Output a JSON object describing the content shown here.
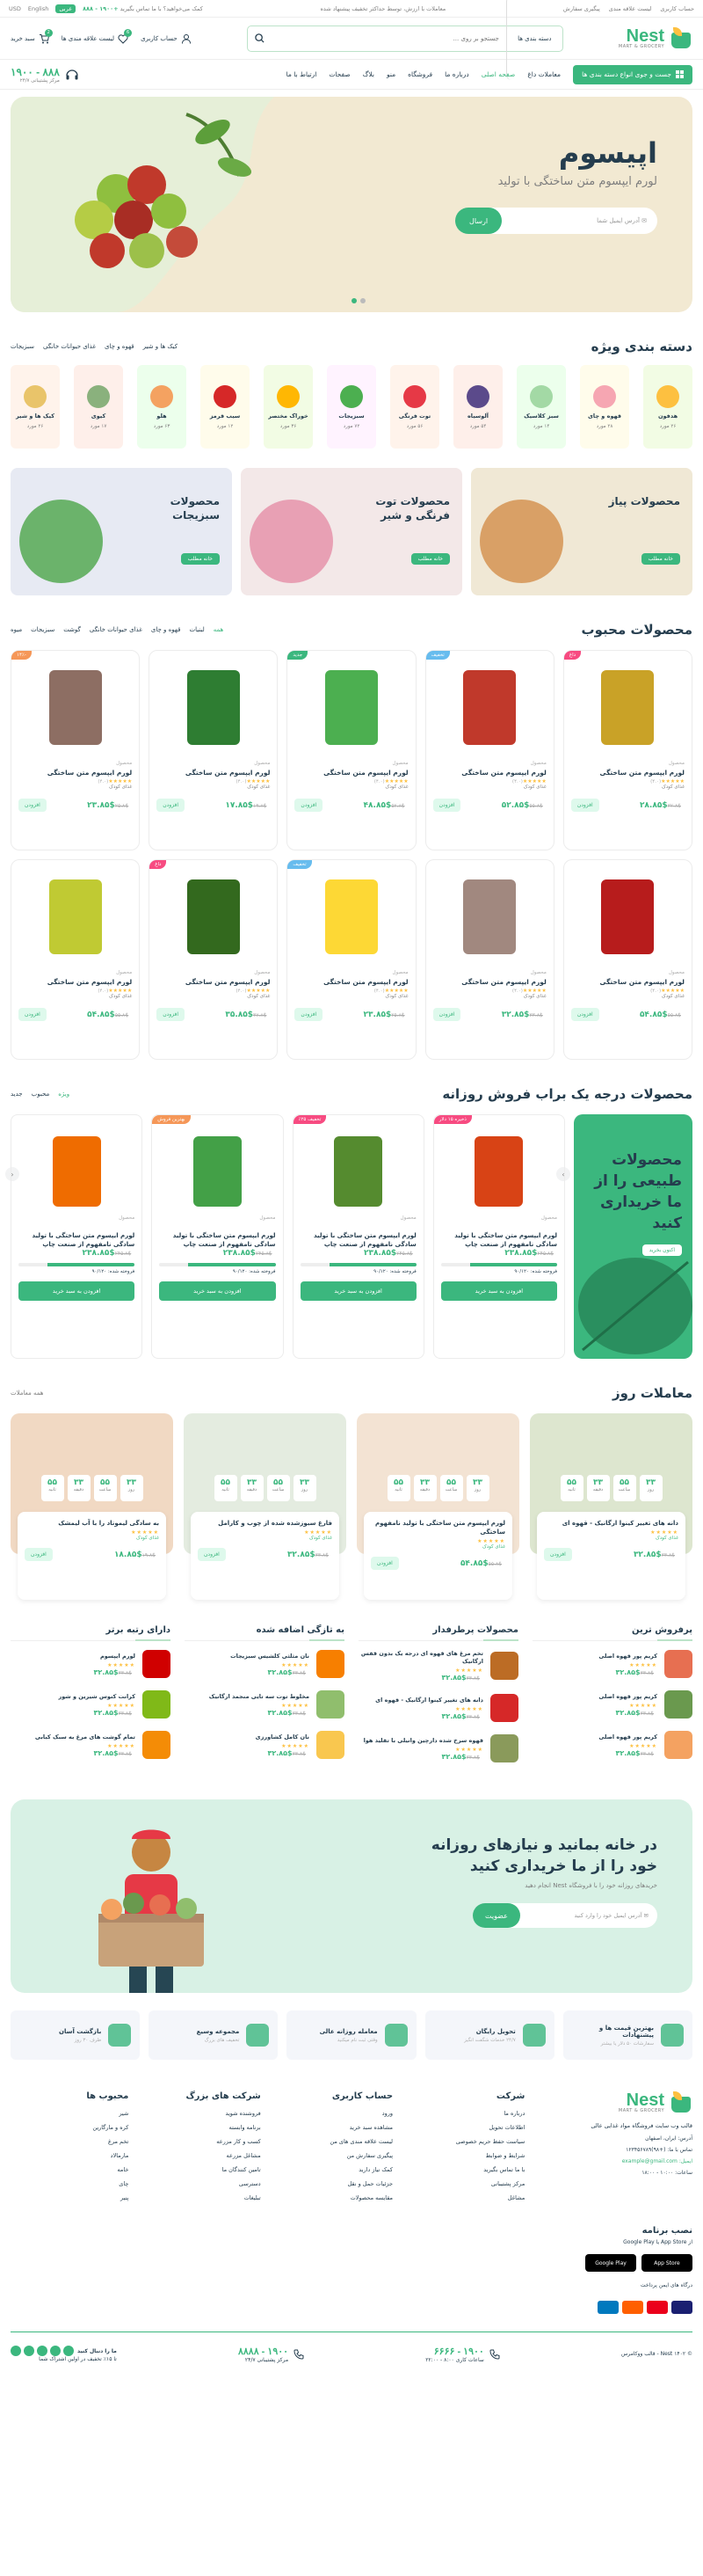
{
  "topbar": {
    "links": [
      "حساب کاربری",
      "لیست علاقه مندی",
      "پیگیری سفارش"
    ],
    "notice": "معاملات با ارزش، توسط حداکثر تخفیف پیشنهاد شده",
    "help": "کمک می‌خواهید؟ با ما تماس بگیرید",
    "phone": "+۱۹۰۰ - ۸۸۸",
    "lang": "English",
    "currency": "USD",
    "lang_badge": "عربی"
  },
  "header": {
    "logo": "Nest",
    "logo_sub": "MART & GROCERY",
    "search_cat": "دسته بندی ها",
    "search_placeholder": "جستجو بر روی ...",
    "account": "حساب کاربری",
    "wishlist": "لیست علاقه مندی ها",
    "wishlist_count": "6",
    "cart": "سبد خرید",
    "cart_count": "2"
  },
  "nav": {
    "allcats": "جست و جوی انواع دسته بندی ها",
    "items": [
      "معاملات داغ",
      "صفحه اصلی",
      "درباره ما",
      "فروشگاه",
      "منو",
      "بلاگ",
      "صفحات",
      "ارتباط با ما"
    ],
    "hotline": "۸۸۸ - ۱۹۰۰",
    "hotline_sub": "مرکز پشتیبانی ۲۴/۷"
  },
  "hero": {
    "title": "اپیسوم",
    "subtitle": "لورم ایپسوم متن ساختگی با تولید",
    "email_placeholder": "آدرس ایمیل شما",
    "button": "ارسال"
  },
  "categories": {
    "title": "دسته بندی ویژه",
    "tabs": [
      "کیک ها و شیر",
      "قهوه و چای",
      "غذای حیوانات خانگی",
      "سبزیجات"
    ],
    "items": [
      {
        "name": "هدفون",
        "count": "۲۶ مورد",
        "bg": "#f2fce4",
        "dot": "#fdc040"
      },
      {
        "name": "قهوه و چای",
        "count": "۲۸ مورد",
        "bg": "#fffceb",
        "dot": "#f6a6b2"
      },
      {
        "name": "سبز کلاسیک",
        "count": "۱۴ مورد",
        "bg": "#ecffec",
        "dot": "#a3d9a5"
      },
      {
        "name": "آلوسیاه",
        "count": "۵۴ مورد",
        "bg": "#feefea",
        "dot": "#5b4a8b"
      },
      {
        "name": "توت فرنگی",
        "count": "۵۶ مورد",
        "bg": "#fff3eb",
        "dot": "#e63946"
      },
      {
        "name": "سبزیجات",
        "count": "۷۲ مورد",
        "bg": "#fff3ff",
        "dot": "#4caf50"
      },
      {
        "name": "خوراک مختصر",
        "count": "۳۶ مورد",
        "bg": "#f2fce4",
        "dot": "#ffb703"
      },
      {
        "name": "سیب قرمز",
        "count": "۱۲ مورد",
        "bg": "#fffceb",
        "dot": "#d62828"
      },
      {
        "name": "هلو",
        "count": "۶۳ مورد",
        "bg": "#ecffec",
        "dot": "#f4a261"
      },
      {
        "name": "کیوی",
        "count": "۱۷ مورد",
        "bg": "#feefea",
        "dot": "#8ab17d"
      },
      {
        "name": "کیک ها و شیر",
        "count": "۲۶ مورد",
        "bg": "#fff3eb",
        "dot": "#e9c46a"
      }
    ]
  },
  "banners": [
    {
      "title": "محصولات پیاز",
      "button": "خانه مطلب",
      "bg": "#f0e8d5",
      "art": "#d9a066"
    },
    {
      "title": "محصولات توت فرنگی و شیر",
      "button": "خانه مطلب",
      "bg": "#f3e8e8",
      "art": "#e8a0b4"
    },
    {
      "title": "محصولات سبزیجات",
      "button": "خانه مطلب",
      "bg": "#e7eaf3",
      "art": "#6bb36b"
    }
  ],
  "popular": {
    "title": "محصولات محبوب",
    "tabs": [
      "همه",
      "لبنیات",
      "قهوه و چای",
      "غذای حیوانات خانگی",
      "گوشت",
      "سبزیجات",
      "میوه"
    ],
    "products": [
      {
        "tag": "داغ",
        "tag_color": "#f74b81",
        "img": "#c9a227",
        "cat": "محصول",
        "name": "لورم ایپسوم متن ساختگی",
        "rating": "(۴.۰)",
        "by": "غذای کودک",
        "price": "۲۸.۸۵$",
        "old": "۳۲.۸$",
        "add": "افزودن"
      },
      {
        "tag": "تخفیف",
        "tag_color": "#67bcee",
        "img": "#c0392b",
        "cat": "محصول",
        "name": "لورم ایپسوم متن ساختگی",
        "rating": "(۴.۰)",
        "by": "غذای کودک",
        "price": "۵۲.۸۵$",
        "old": "۵۵.۸$",
        "add": "افزودن"
      },
      {
        "tag": "جدید",
        "tag_color": "#3bb77e",
        "img": "#4caf50",
        "cat": "محصول",
        "name": "لورم ایپسوم متن ساختگی",
        "rating": "(۴.۰)",
        "by": "غذای کودک",
        "price": "۴۸.۸۵$",
        "old": "۵۲.۸$",
        "add": "افزودن"
      },
      {
        "tag": "",
        "tag_color": "",
        "img": "#2e7d32",
        "cat": "محصول",
        "name": "لورم ایپسوم متن ساختگی",
        "rating": "(۴.۰)",
        "by": "غذای کودک",
        "price": "۱۷.۸۵$",
        "old": "۱۹.۸$",
        "add": "افزودن"
      },
      {
        "tag": "-۱۴٪",
        "tag_color": "#f59758",
        "img": "#8d6e63",
        "cat": "محصول",
        "name": "لورم ایپسوم متن ساختگی",
        "rating": "(۴.۰)",
        "by": "غذای کودک",
        "price": "۲۳.۸۵$",
        "old": "۲۵.۸$",
        "add": "افزودن"
      },
      {
        "tag": "",
        "tag_color": "",
        "img": "#b71c1c",
        "cat": "محصول",
        "name": "لورم ایپسوم متن ساختگی",
        "rating": "(۴.۰)",
        "by": "غذای کودک",
        "price": "۵۴.۸۵$",
        "old": "۵۵.۸$",
        "add": "افزودن"
      },
      {
        "tag": "",
        "tag_color": "",
        "img": "#a1887f",
        "cat": "محصول",
        "name": "لورم ایپسوم متن ساختگی",
        "rating": "(۴.۰)",
        "by": "غذای کودک",
        "price": "۳۲.۸۵$",
        "old": "۳۳.۸$",
        "add": "افزودن"
      },
      {
        "tag": "تخفیف",
        "tag_color": "#67bcee",
        "img": "#fdd835",
        "cat": "محصول",
        "name": "لورم ایپسوم متن ساختگی",
        "rating": "(۴.۰)",
        "by": "غذای کودک",
        "price": "۲۳.۸۵$",
        "old": "۲۵.۸$",
        "add": "افزودن"
      },
      {
        "tag": "داغ",
        "tag_color": "#f74b81",
        "img": "#33691e",
        "cat": "محصول",
        "name": "لورم ایپسوم متن ساختگی",
        "rating": "(۴.۰)",
        "by": "غذای کودک",
        "price": "۳۵.۸۵$",
        "old": "۳۷.۸$",
        "add": "افزودن"
      },
      {
        "tag": "",
        "tag_color": "",
        "img": "#c0ca33",
        "cat": "محصول",
        "name": "لورم ایپسوم متن ساختگی",
        "rating": "(۴.۰)",
        "by": "غذای کودک",
        "price": "۵۴.۸۵$",
        "old": "۵۵.۸$",
        "add": "افزودن"
      }
    ]
  },
  "daily": {
    "title": "محصولات درجه یک براب فروش روزانه",
    "tabs": [
      "ویژه",
      "محبوب",
      "جدید"
    ],
    "banner_title": "محصولات طبیعی را از ما خریداری کنید",
    "banner_button": "اکنون بخرید",
    "items": [
      {
        "tag": "ذخیره ۱۵ دلار",
        "tag_color": "#f74b81",
        "img": "#d84315",
        "cat": "محصول",
        "name": "لورم ایپسوم متن ساختگی با تولید سادگی نامفهوم از صنعت چاپ",
        "price": "۲۳۸.۸۵$",
        "old": "۲۴۵.۸$",
        "sold_label": "فروخته شده: ۹۰/۱۲۰",
        "sold_pct": 75,
        "button": "افزودن به سبد خرید"
      },
      {
        "tag": "تخفیف ۲۵٪",
        "tag_color": "#f74b81",
        "img": "#558b2f",
        "cat": "محصول",
        "name": "لورم ایپسوم متن ساختگی با تولید سادگی نامفهوم از صنعت چاپ",
        "price": "۲۳۸.۸۵$",
        "old": "۲۴۵.۸$",
        "sold_label": "فروخته شده: ۹۰/۱۲۰",
        "sold_pct": 75,
        "button": "افزودن به سبد خرید"
      },
      {
        "tag": "بهترین فروش",
        "tag_color": "#f59758",
        "img": "#43a047",
        "cat": "محصول",
        "name": "لورم ایپسوم متن ساختگی با تولید سادگی نامفهوم از صنعت چاپ",
        "price": "۲۳۸.۸۵$",
        "old": "۲۴۵.۸$",
        "sold_label": "فروخته شده: ۹۰/۱۲۰",
        "sold_pct": 75,
        "button": "افزودن به سبد خرید"
      },
      {
        "tag": "",
        "tag_color": "",
        "img": "#ef6c00",
        "cat": "محصول",
        "name": "لورم ایپسوم متن ساختگی با تولید سادگی نامفهوم از صنعت چاپ",
        "price": "۲۳۸.۸۵$",
        "old": "۲۴۵.۸$",
        "sold_label": "فروخته شده: ۹۰/۱۲۰",
        "sold_pct": 75,
        "button": "افزودن به سبد خرید"
      }
    ]
  },
  "deals": {
    "title": "معاملات روز",
    "all": "همه معاملات",
    "items": [
      {
        "pic": "#dde6cf",
        "timer": [
          "۳۳",
          "۵۵",
          "۳۳",
          "۵۵"
        ],
        "units": [
          "روز",
          "ساعت",
          "دقیقه",
          "ثانیه"
        ],
        "name": "دانه های تغییر کینوا ارگانیک - قهوه ای",
        "by": "غذای کودک",
        "price": "۳۲.۸۵$",
        "old": "۳۳.۸$",
        "add": "افزودن"
      },
      {
        "pic": "#f3e3d3",
        "timer": [
          "۳۳",
          "۵۵",
          "۳۳",
          "۵۵"
        ],
        "units": [
          "روز",
          "ساعت",
          "دقیقه",
          "ثانیه"
        ],
        "name": "لورم ایپسوم متن ساختگی با تولید نامفهوم ساختگی",
        "by": "غذای کودک",
        "price": "۵۴.۸۵$",
        "old": "۵۵.۸$",
        "add": "افزودن"
      },
      {
        "pic": "#e4ece0",
        "timer": [
          "۳۳",
          "۵۵",
          "۳۳",
          "۵۵"
        ],
        "units": [
          "روز",
          "ساعت",
          "دقیقه",
          "ثانیه"
        ],
        "name": "فارغ سبوزشده شده از چوب و کارامل",
        "by": "غذای کودک",
        "price": "۳۲.۸۵$",
        "old": "۳۳.۸$",
        "add": "افزودن"
      },
      {
        "pic": "#f1d9c3",
        "timer": [
          "۳۳",
          "۵۵",
          "۳۳",
          "۵۵"
        ],
        "units": [
          "روز",
          "ساعت",
          "دقیقه",
          "ثانیه"
        ],
        "name": "به سادگی لیموناد را با آب لیمشک",
        "by": "غذای کودک",
        "price": "۱۸.۸۵$",
        "old": "۱۹.۸$",
        "add": "افزودن"
      }
    ]
  },
  "columns": [
    {
      "title": "پرفروش ترین",
      "items": [
        {
          "img": "#e76f51",
          "name": "کریم پور قهوه اصلی",
          "price": "۳۲.۸۵$",
          "old": "۳۳.۸$"
        },
        {
          "img": "#6a994e",
          "name": "کریم پور قهوه اصلی",
          "price": "۳۲.۸۵$",
          "old": "۳۳.۸$"
        },
        {
          "img": "#f4a261",
          "name": "کریم پور قهوه اصلی",
          "price": "۳۲.۸۵$",
          "old": "۳۳.۸$"
        }
      ]
    },
    {
      "title": "محصولات پرطرفدار",
      "items": [
        {
          "img": "#bc6c25",
          "name": "تخم مرغ های قهوه ای درجه یک بدون قفس ارگانیک",
          "price": "۳۲.۸۵$",
          "old": "۳۳.۸$"
        },
        {
          "img": "#d62828",
          "name": "دانه های تغییر کینوا ارگانیک - قهوه ای",
          "price": "۳۲.۸۵$",
          "old": "۳۳.۸$"
        },
        {
          "img": "#8a9a5b",
          "name": "قهوه سرخ شده دارچین وانیلی با تقلید هوا",
          "price": "۳۲.۸۵$",
          "old": "۳۳.۸$"
        }
      ]
    },
    {
      "title": "به تازگی اضافه شده",
      "items": [
        {
          "img": "#f77f00",
          "name": "نان مثلثی کلشیس سبزیجات",
          "price": "۳۲.۸۵$",
          "old": "۳۳.۸$"
        },
        {
          "img": "#90be6d",
          "name": "مخلوط توت سه تایی منجمد ارگانیک",
          "price": "۳۲.۸۵$",
          "old": "۳۳.۸$"
        },
        {
          "img": "#f9c74f",
          "name": "نان کامل کشاورزی",
          "price": "۳۲.۸۵$",
          "old": "۳۳.۸$"
        }
      ]
    },
    {
      "title": "دارای رتبه برتر",
      "items": [
        {
          "img": "#d00000",
          "name": "لورم ایپسوم",
          "price": "۳۲.۸۵$",
          "old": "۳۳.۸$"
        },
        {
          "img": "#80b918",
          "name": "کرانت کنوس شیرین و شور",
          "price": "۳۲.۸۵$",
          "old": "۳۳.۸$"
        },
        {
          "img": "#f48c06",
          "name": "تمام گوشت های مرغ به سبک کبابی",
          "price": "۳۲.۸۵$",
          "old": "۳۳.۸$"
        }
      ]
    }
  ],
  "newsletter": {
    "title": "در خانه بمانید و نیازهای روزانه خود را از ما خریداری کنید",
    "subtitle": "خریدهای روزانه خود را با فروشگاه Nest انجام دهید",
    "placeholder": "آدرس ایمیل خود را وارد کنید",
    "button": "عضویت"
  },
  "features": [
    {
      "title": "بهترین قیمت ها و پیشنهادات",
      "sub": "سفارشات ۵۰ دلار یا بیشتر"
    },
    {
      "title": "تحویل رایگان",
      "sub": "۲۴/۷ خدمات شگفت انگیز"
    },
    {
      "title": "معامله روزانه عالی",
      "sub": "وقتی ثبت نام میکنید"
    },
    {
      "title": "مجموعه وسیع",
      "sub": "تخفیف های بزرگ"
    },
    {
      "title": "بازگشت آسان",
      "sub": "ظرف ۳۰ روز"
    }
  ],
  "footer": {
    "about": "قالب وب سایت فروشگاه مواد غذایی عالی",
    "address": "آدرس: ایران، اصفهان",
    "phone": "تماس با ما: (+۹۸)۱۲۳۴۵۶۷۸۹",
    "email": "ایمیل: example@gmail.com",
    "hours": "ساعات: ۱۰:۰۰ - ۱۸:۰۰",
    "cols": [
      {
        "title": "شرکت",
        "items": [
          "درباره ما",
          "اطلاعات تحویل",
          "سیاست حفظ حریم خصوصی",
          "شرایط و ضوابط",
          "با ما تماس بگیرید",
          "مرکز پشتیبانی",
          "مشاغل"
        ]
      },
      {
        "title": "حساب کاربری",
        "items": [
          "ورود",
          "مشاهده سبد خرید",
          "لیست علاقه مندی های من",
          "پیگیری سفارش من",
          "کمک نیاز دارید",
          "جزئیات حمل و نقل",
          "مقایسه محصولات"
        ]
      },
      {
        "title": "شرکت های بزرگ",
        "items": [
          "فروشنده شوید",
          "برنامه وابسته",
          "کسب و کار مزرعه",
          "مشاغل مزرعه",
          "تامین کنندگان ما",
          "دسترسی",
          "تبلیغات"
        ]
      },
      {
        "title": "محبوب ها",
        "items": [
          "شیر",
          "کره و مارگارین",
          "تخم مرغ",
          "مارمالاد",
          "خامه",
          "چای",
          "پنیر"
        ]
      }
    ],
    "app_title": "نصب برنامه",
    "app_sub": "از App Store یا Google Play",
    "app_store": "App Store",
    "google_play": "Google Play",
    "pay_label": "درگاه های ایمن پرداخت",
    "pay_colors": [
      "#1a1f71",
      "#eb001b",
      "#ff5f00",
      "#0079be"
    ]
  },
  "copyright": {
    "text": "© ۱۴۰۲ Nest - قالب ووکامرس",
    "hot1": "۱۹۰۰ - ۶۶۶۶",
    "hot1_sub": "ساعات کاری ۸:۰۰ - ۲۲:۰۰",
    "hot2": "۱۹۰۰ - ۸۸۸۸",
    "hot2_sub": "مرکز پشتیبانی ۲۴/۷",
    "follow": "ما را دنبال کنید",
    "follow_sub": "تا ۱۵٪ تخفیف در اولین اشتراک شما"
  }
}
